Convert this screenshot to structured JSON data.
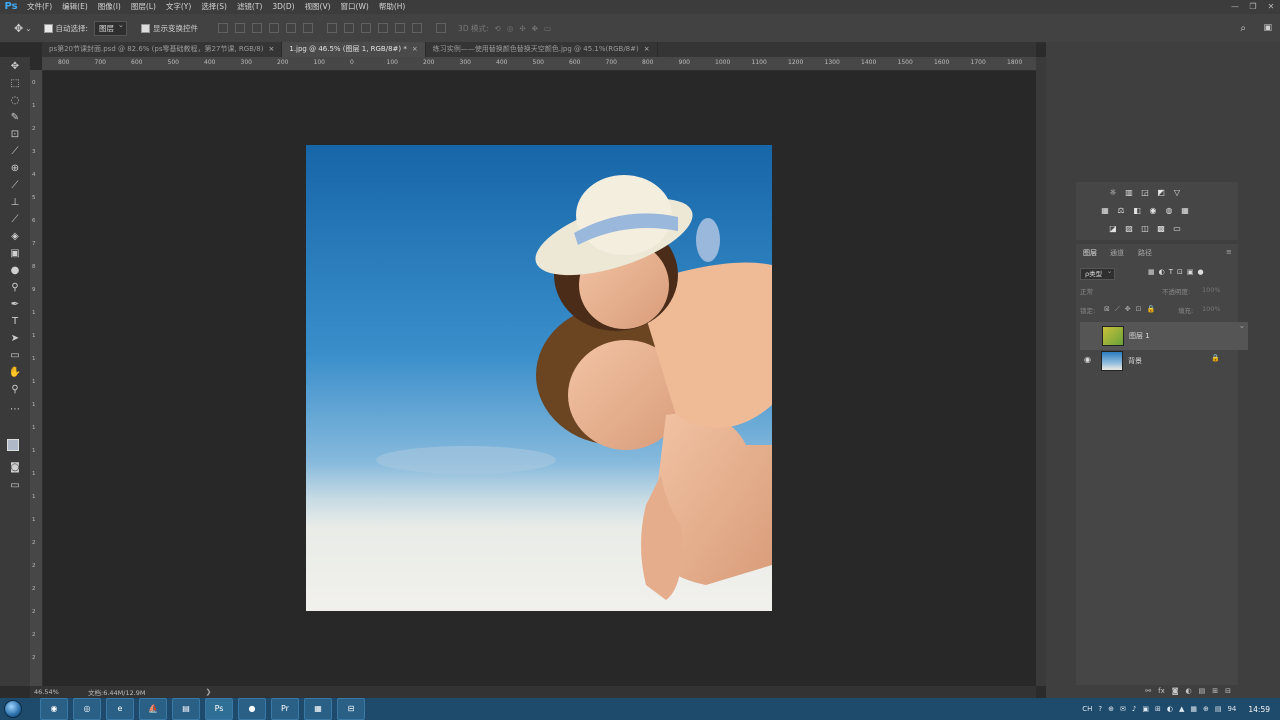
{
  "app": {
    "logo": "Ps"
  },
  "menu": [
    "文件(F)",
    "编辑(E)",
    "图像(I)",
    "图层(L)",
    "文字(Y)",
    "选择(S)",
    "滤镜(T)",
    "3D(D)",
    "视图(V)",
    "窗口(W)",
    "帮助(H)"
  ],
  "window_controls": [
    "—",
    "❐",
    "✕"
  ],
  "options": {
    "auto_select_label": "自动选择:",
    "auto_select_value": "图层",
    "show_transform_label": "显示变换控件",
    "mode_3d_label": "3D 模式:"
  },
  "tabs": [
    {
      "label": "ps第20节课封面.psd @ 82.6% (ps零基础教程，第27节课, RGB/8)",
      "close": "×"
    },
    {
      "label": "1.jpg @ 46.5% (图层 1, RGB/8#) *",
      "close": "×"
    },
    {
      "label": "练习实例——使用替换颜色替换天空颜色.jpg @ 45.1%(RGB/8#)",
      "close": "×"
    }
  ],
  "ruler_top_labels": [
    "800",
    "700",
    "600",
    "500",
    "400",
    "300",
    "200",
    "100",
    "0",
    "100",
    "200",
    "300",
    "400",
    "500",
    "600",
    "700",
    "800",
    "900",
    "1000",
    "1100",
    "1200",
    "1300",
    "1400",
    "1500",
    "1600",
    "1700",
    "1800",
    "1900",
    "2000",
    "2100",
    "2200"
  ],
  "ruler_left_labels": [
    "0",
    "1",
    "2",
    "3",
    "4",
    "5",
    "6",
    "7",
    "8",
    "9",
    "1",
    "1",
    "1",
    "1",
    "1",
    "1",
    "1",
    "1",
    "1",
    "1",
    "2",
    "2",
    "2",
    "2",
    "2",
    "2"
  ],
  "status": {
    "zoom": "46.54%",
    "doc": "文档:6.44M/12.9M",
    "arrow": "❯"
  },
  "layers_panel": {
    "tabs": [
      "图层",
      "通道",
      "路径"
    ],
    "filter_kind": "ρ类型",
    "blend_mode": "正常",
    "opacity_label": "不透明度:",
    "opacity_value": "100%",
    "lock_label": "锁定:",
    "fill_label": "填充:",
    "fill_value": "100%",
    "layers": [
      {
        "name": "图层 1",
        "visible": false,
        "selected": true
      },
      {
        "name": "背景",
        "visible": true,
        "locked": true
      }
    ]
  },
  "taskbar": {
    "apps": [
      "◉",
      "◎",
      "e",
      "⛵",
      "▤",
      "Ps",
      "●",
      "Pr",
      "▦",
      "⊟"
    ],
    "tray": [
      "CH",
      "?",
      "⊕",
      "✉",
      "♪",
      "▣",
      "⊞",
      "◐",
      "▲",
      "▦",
      "⊕",
      "▤",
      "94"
    ],
    "clock": "14:59"
  },
  "colors": {
    "accent": "#3fa9f5",
    "taskbar": "#1e4a6b",
    "canvas": "#282828"
  }
}
